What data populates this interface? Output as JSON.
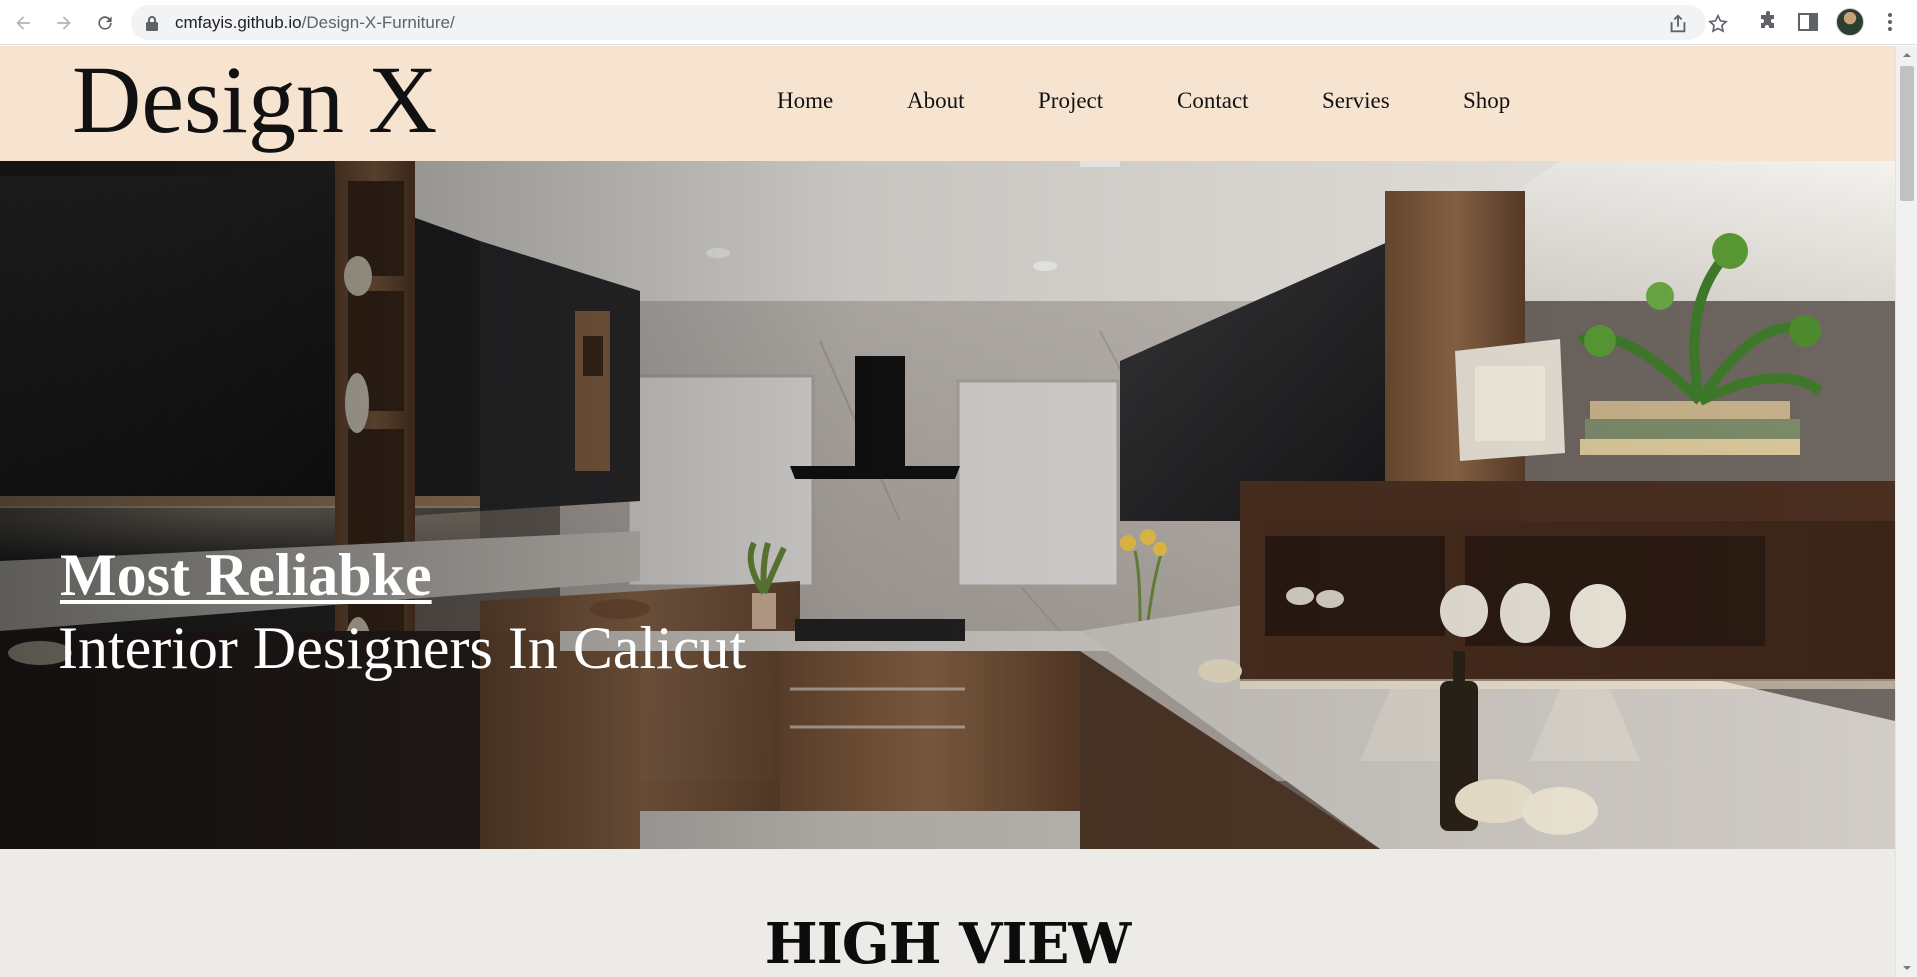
{
  "browser": {
    "url_host": "cmfayis.github.io",
    "url_path": "/Design-X-Furniture/",
    "icons": [
      "back-arrow-icon",
      "forward-arrow-icon",
      "reload-icon",
      "lock-icon",
      "share-icon",
      "bookmark-star-icon",
      "extensions-puzzle-icon",
      "side-panel-icon",
      "profile-avatar",
      "kebab-menu-icon"
    ]
  },
  "site": {
    "logo": "Design X",
    "nav": [
      "Home",
      "About",
      "Project",
      "Contact",
      "Servies",
      "Shop"
    ],
    "header_color": "#f6e4d1"
  },
  "hero": {
    "title": "Most Reliabke",
    "subtitle": "Interior Designers In Calicut"
  },
  "section": {
    "title": "HIGH VIEW",
    "background": "#ecebe8"
  }
}
